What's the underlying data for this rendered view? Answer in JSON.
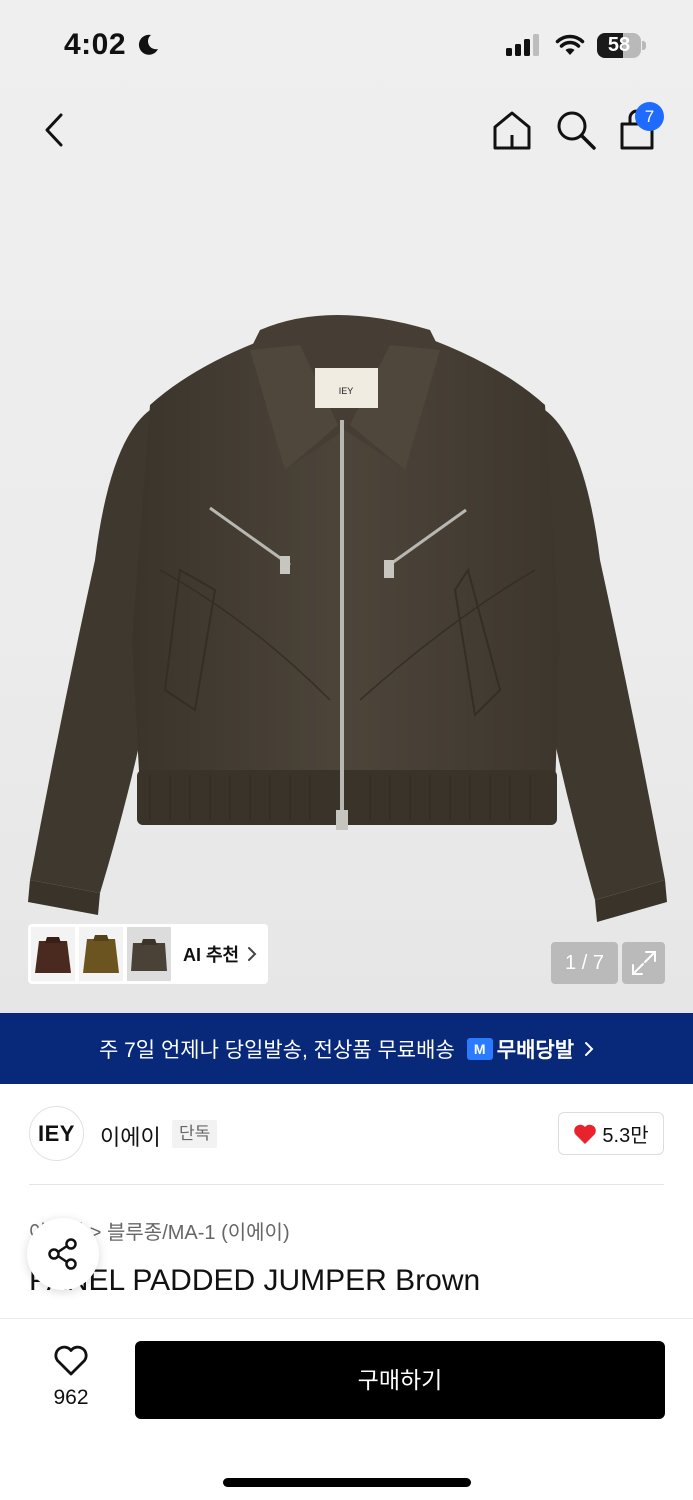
{
  "status_bar": {
    "time": "4:02",
    "battery_level": "58",
    "battery_fraction": 0.58
  },
  "nav": {
    "back_icon": "chevron-left-icon",
    "home_icon": "home-icon",
    "search_icon": "search-icon",
    "cart_icon": "shopping-bag-icon",
    "cart_count": "7"
  },
  "gallery": {
    "ai_recommend_label": "AI 추천",
    "page_counter": "1 / 7",
    "expand_icon": "expand-icon",
    "jacket_logo_text": "IEY"
  },
  "promo": {
    "text": "주 7일 언제나 당일발송, 전상품 무료배송",
    "badge_text": "M",
    "brand_label": "무배당발"
  },
  "brand": {
    "logo_text": "IEY",
    "name": "이에이",
    "tag": "단독",
    "likes": "5.3만"
  },
  "product": {
    "breadcrumb": "아우터 > 블루종/MA-1 (이에이)",
    "title": "PANEL PADDED JUMPER Brown"
  },
  "bottom_bar": {
    "wish_count": "962",
    "buy_label": "구매하기"
  },
  "colors": {
    "promo_bg": "#08287a",
    "badge_blue": "#1f6bff",
    "heart_red": "#e8232e",
    "jacket_brown": "#4a4237"
  }
}
